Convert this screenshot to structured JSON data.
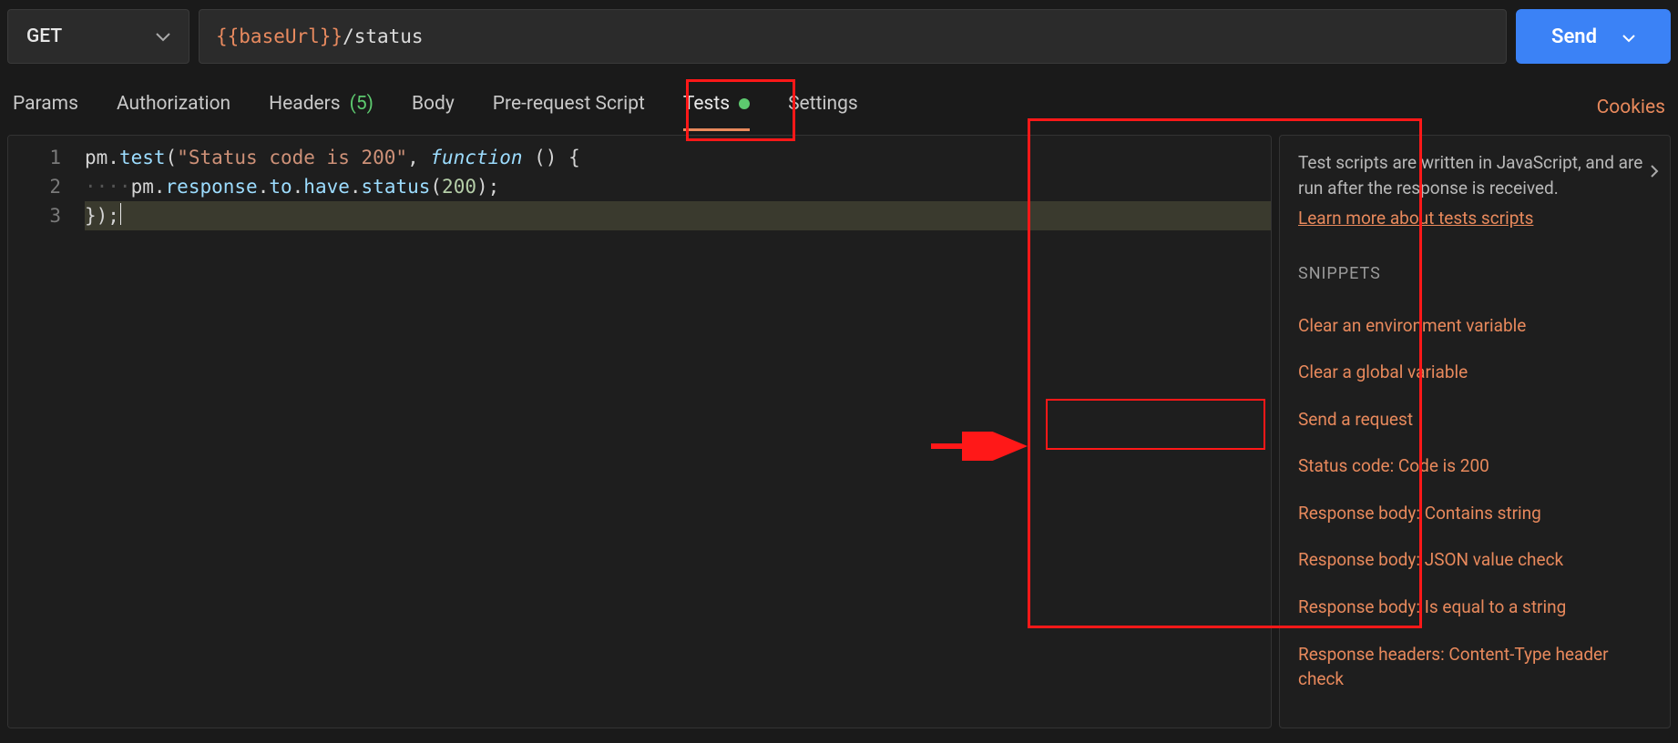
{
  "request": {
    "method": "GET",
    "url_variable": "{{baseUrl}}",
    "url_path": "/status",
    "send_label": "Send"
  },
  "tabs": {
    "params": "Params",
    "authorization": "Authorization",
    "headers": "Headers",
    "headers_count": "(5)",
    "body": "Body",
    "prerequest": "Pre-request Script",
    "tests": "Tests",
    "settings": "Settings",
    "cookies": "Cookies"
  },
  "editor": {
    "line_numbers": [
      "1",
      "2",
      "3"
    ],
    "line1": {
      "t1": "pm",
      "t2": ".",
      "t3": "test",
      "t4": "(",
      "t5": "\"Status code is 200\"",
      "t6": ", ",
      "t7": "function",
      "t8": " () {"
    },
    "line2": {
      "indent": "····",
      "t1": "pm",
      "t2": ".",
      "t3": "response",
      "t4": ".",
      "t5": "to",
      "t6": ".",
      "t7": "have",
      "t8": ".",
      "t9": "status",
      "t10": "(",
      "t11": "200",
      "t12": ");"
    },
    "line3": "});"
  },
  "side": {
    "description": "Test scripts are written in JavaScript, and are run after the response is received.",
    "learn_link": "Learn more about tests scripts",
    "snippets_header": "SNIPPETS",
    "snippets": [
      "Clear an environment variable",
      "Clear a global variable",
      "Send a request",
      "Status code: Code is 200",
      "Response body: Contains string",
      "Response body: JSON value check",
      "Response body: Is equal to a string",
      "Response headers: Content-Type header check"
    ]
  }
}
